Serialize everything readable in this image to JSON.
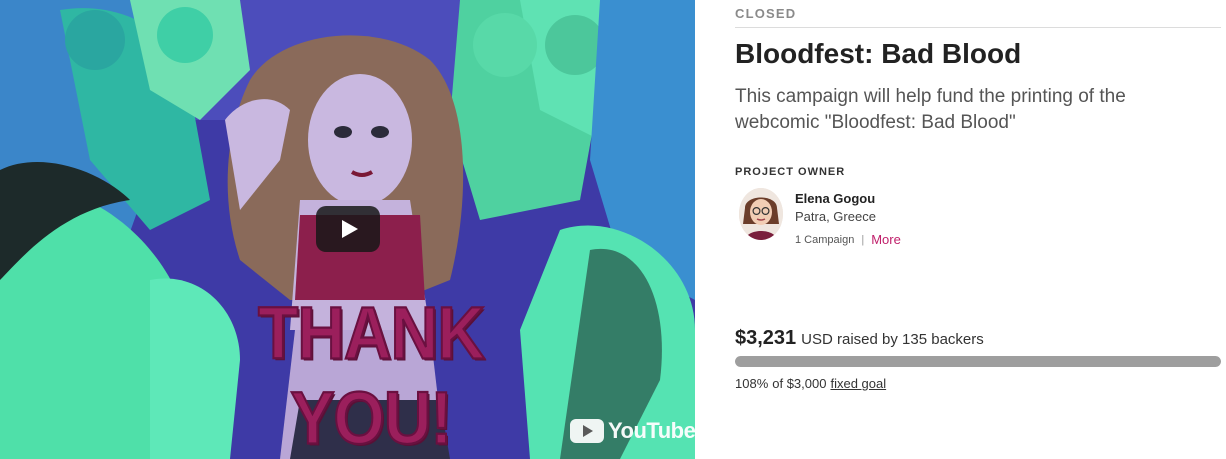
{
  "video": {
    "overlay_text": "THANK YOU!",
    "play_icon": "play-icon",
    "youtube_label": "YouTube",
    "youtube_icon": "youtube-play-icon"
  },
  "campaign": {
    "status": "CLOSED",
    "title": "Bloodfest: Bad Blood",
    "subtitle": "This campaign will help fund the printing of the webcomic \"Bloodfest: Bad Blood\""
  },
  "owner": {
    "label": "PROJECT OWNER",
    "name": "Elena Gogou",
    "location": "Patra, Greece",
    "campaigns": "1 Campaign",
    "separator": "|",
    "more_label": "More"
  },
  "funding": {
    "amount": "$3,231",
    "raised_text": "USD raised by 135 backers",
    "progress_fraction": 1.0,
    "percent": "108%",
    "of_text": "of $3,000",
    "goal_link": "fixed goal"
  },
  "colors": {
    "accent": "#c0206b",
    "progress": "#9e9e9e",
    "overlay_text": "#9b1f5c"
  }
}
